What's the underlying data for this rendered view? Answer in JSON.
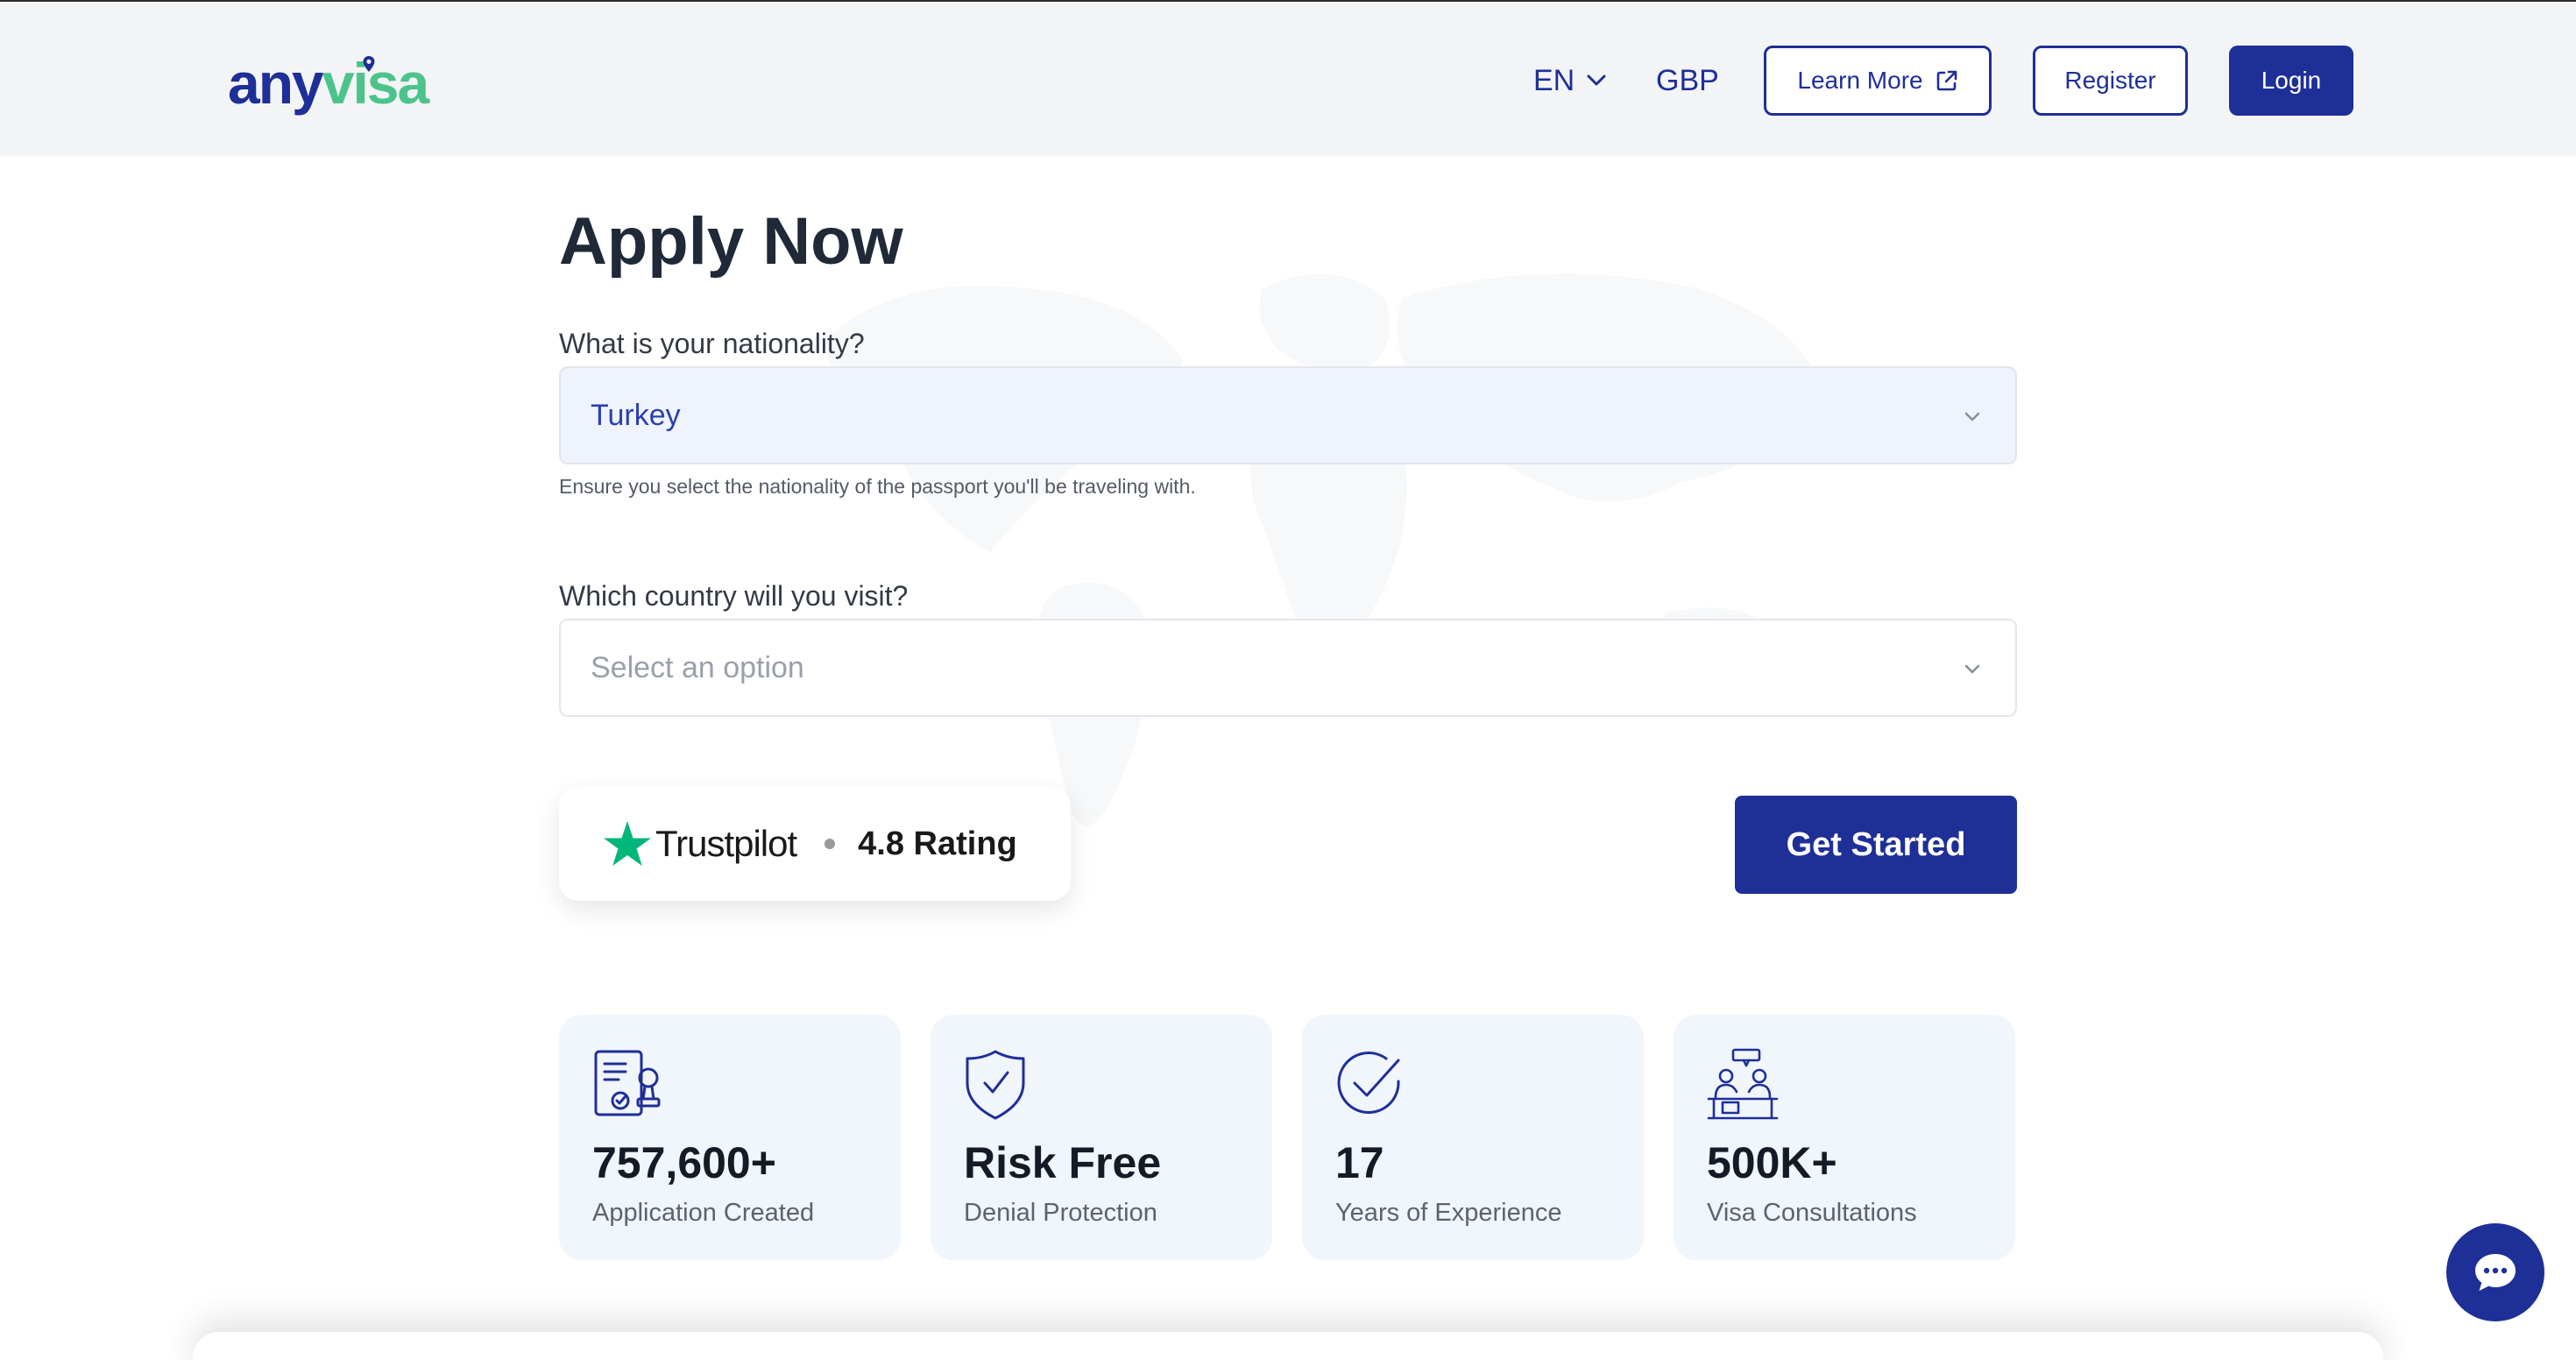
{
  "brand": {
    "part1": "any",
    "part2": "visa"
  },
  "nav": {
    "language": "EN",
    "currency": "GBP",
    "learn_more": "Learn More",
    "register": "Register",
    "login": "Login"
  },
  "form": {
    "title": "Apply Now",
    "nationality_label": "What is your nationality?",
    "nationality_value": "Turkey",
    "nationality_hint": "Ensure you select the nationality of the passport you'll be traveling with.",
    "destination_label": "Which country will you visit?",
    "destination_placeholder": "Select an option",
    "submit": "Get Started"
  },
  "trustpilot": {
    "brand": "Trustpilot",
    "rating": "4.8 Rating"
  },
  "stats": [
    {
      "value": "757,600+",
      "caption": "Application Created",
      "icon": "document-stamp-icon"
    },
    {
      "value": "Risk Free",
      "caption": "Denial Protection",
      "icon": "shield-check-icon"
    },
    {
      "value": "17",
      "caption": "Years of Experience",
      "icon": "circle-check-icon"
    },
    {
      "value": "500K+",
      "caption": "Visa Consultations",
      "icon": "consultation-icon"
    }
  ],
  "colors": {
    "primary": "#1e2f97",
    "brand_green": "#4cc38a",
    "header_bg": "#f3f4f6",
    "card_bg": "#f1f5fc",
    "trustpilot_green": "#00b67a"
  }
}
